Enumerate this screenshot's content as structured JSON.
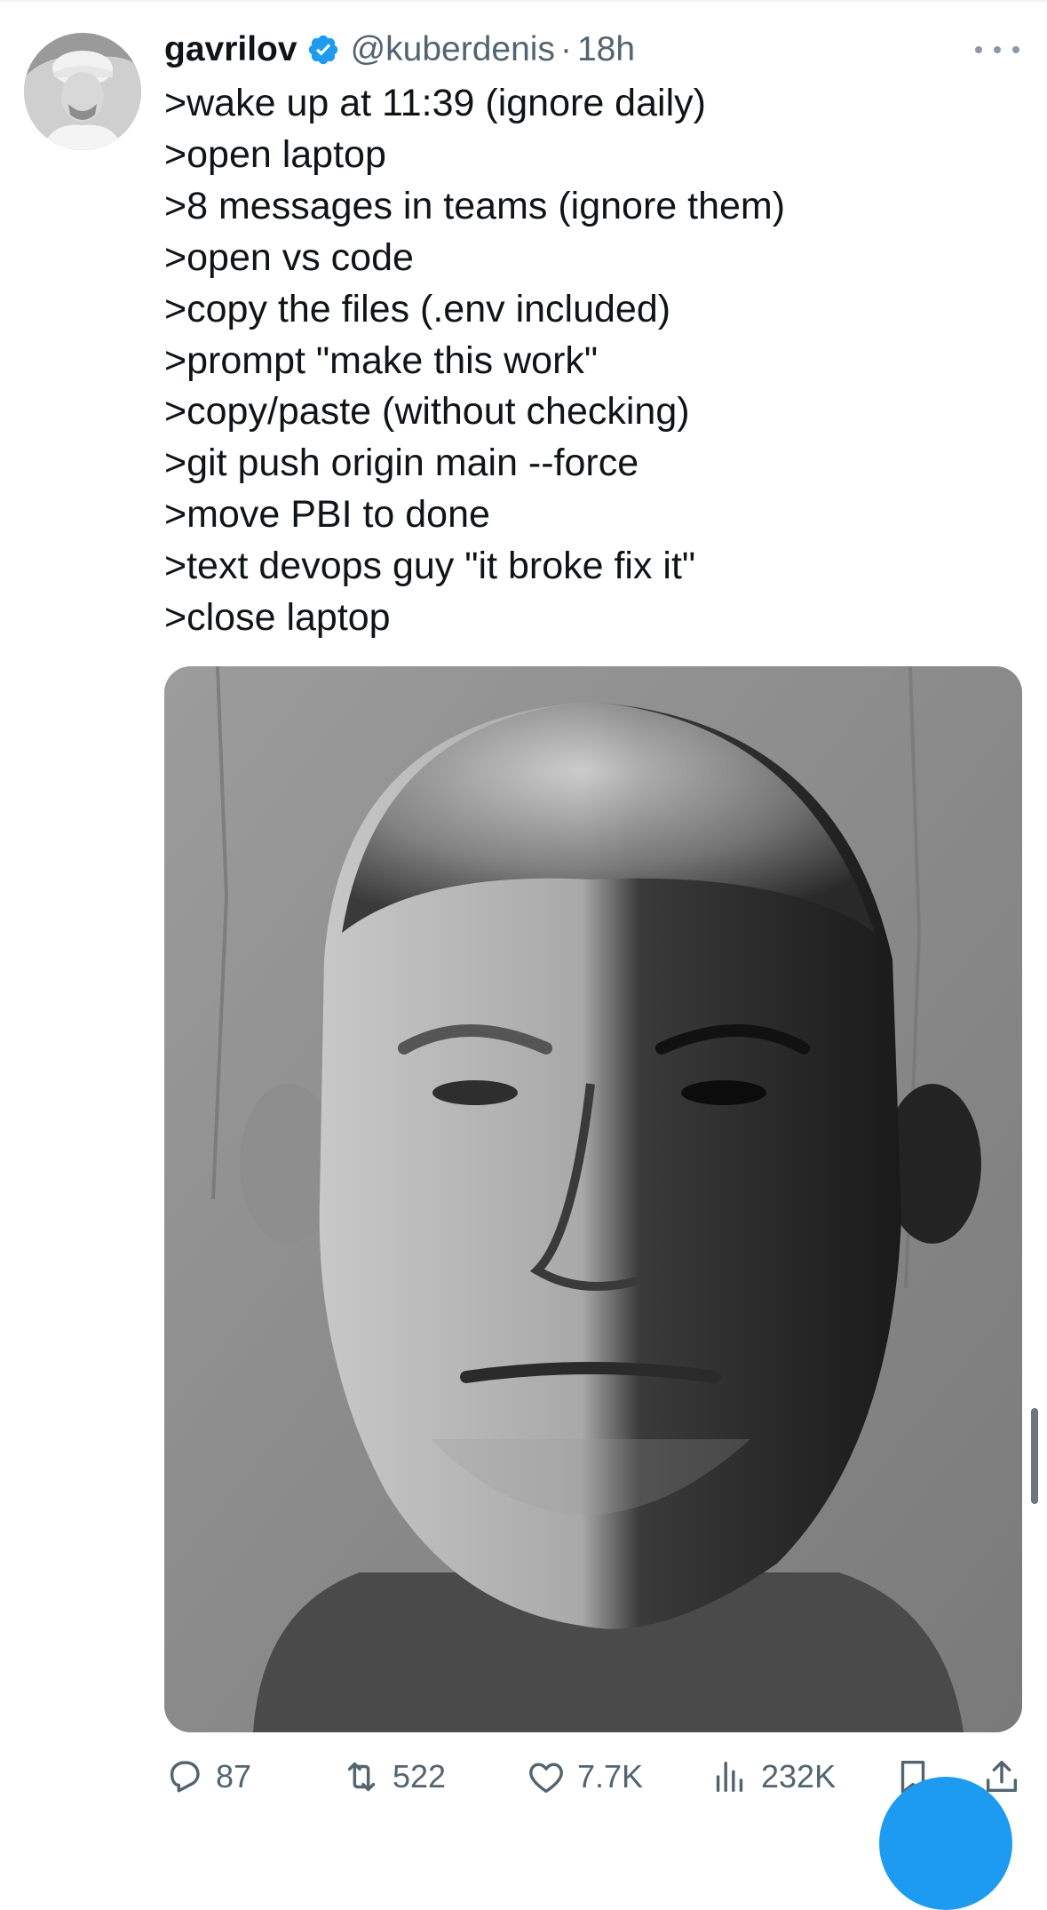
{
  "colors": {
    "text_primary": "#0f1419",
    "text_secondary": "#536471",
    "verified_blue": "#1d9bf0",
    "background": "#ffffff"
  },
  "tweet": {
    "author": {
      "display_name": "gavrilov",
      "handle": "@kuberdenis",
      "separator": "·",
      "time": "18h",
      "verified_icon": "verified-badge-icon",
      "avatar_icon": "avatar"
    },
    "lines": [
      ">wake up at 11:39 (ignore daily)",
      ">open laptop",
      ">8 messages in teams (ignore them)",
      ">open vs code",
      ">copy the files (.env included)",
      ">prompt \"make this work\"",
      ">copy/paste (without checking)",
      ">git push origin main --force",
      ">move PBI to done",
      ">text devops guy \"it broke fix it\"",
      ">close laptop"
    ],
    "media_icon": "photo",
    "actions": {
      "replies": "87",
      "retweets": "522",
      "likes": "7.7K",
      "views": "232K",
      "reply_icon": "reply-icon",
      "retweet_icon": "retweet-icon",
      "like_icon": "heart-icon",
      "views_icon": "views-chart-icon",
      "bookmark_icon": "bookmark-icon",
      "share_icon": "share-icon"
    },
    "more_icon": "more-options-icon"
  }
}
